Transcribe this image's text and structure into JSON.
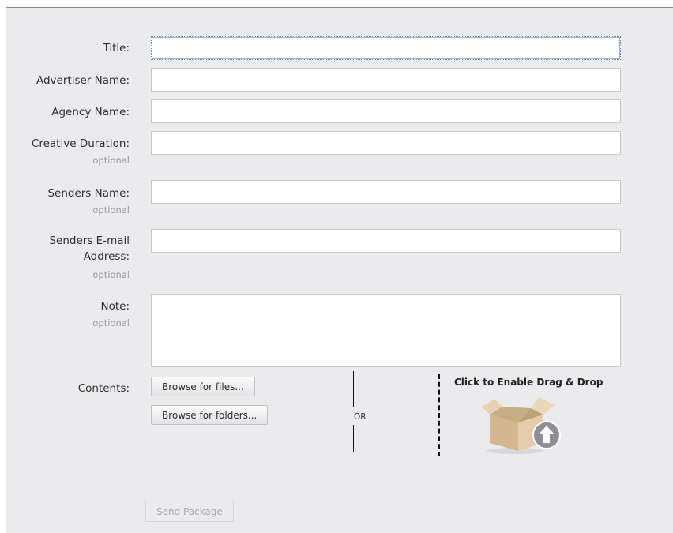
{
  "form": {
    "title_label": "Title:",
    "title_value": "",
    "advertiser_label": "Advertiser Name:",
    "advertiser_value": "",
    "agency_label": "Agency Name:",
    "agency_value": "",
    "duration_label": "Creative Duration:",
    "duration_hint": "optional",
    "duration_value": "",
    "senders_name_label": "Senders Name:",
    "senders_name_hint": "optional",
    "senders_name_value": "",
    "senders_email_label_line1": "Senders E-mail",
    "senders_email_label_line2": "Address:",
    "senders_email_hint": "optional",
    "senders_email_value": "",
    "note_label": "Note:",
    "note_hint": "optional",
    "note_value": ""
  },
  "contents": {
    "label": "Contents:",
    "browse_files": "Browse for files...",
    "browse_folders": "Browse for folders...",
    "or_text": "OR",
    "drag_drop_title": "Click to Enable Drag & Drop",
    "drop_icon": "box-upload-icon"
  },
  "actions": {
    "send_label": "Send Package",
    "send_enabled": false
  },
  "colors": {
    "panel_bg": "#ebebee",
    "box": "#d9c2a0",
    "upload_badge": "#8e8e93"
  }
}
